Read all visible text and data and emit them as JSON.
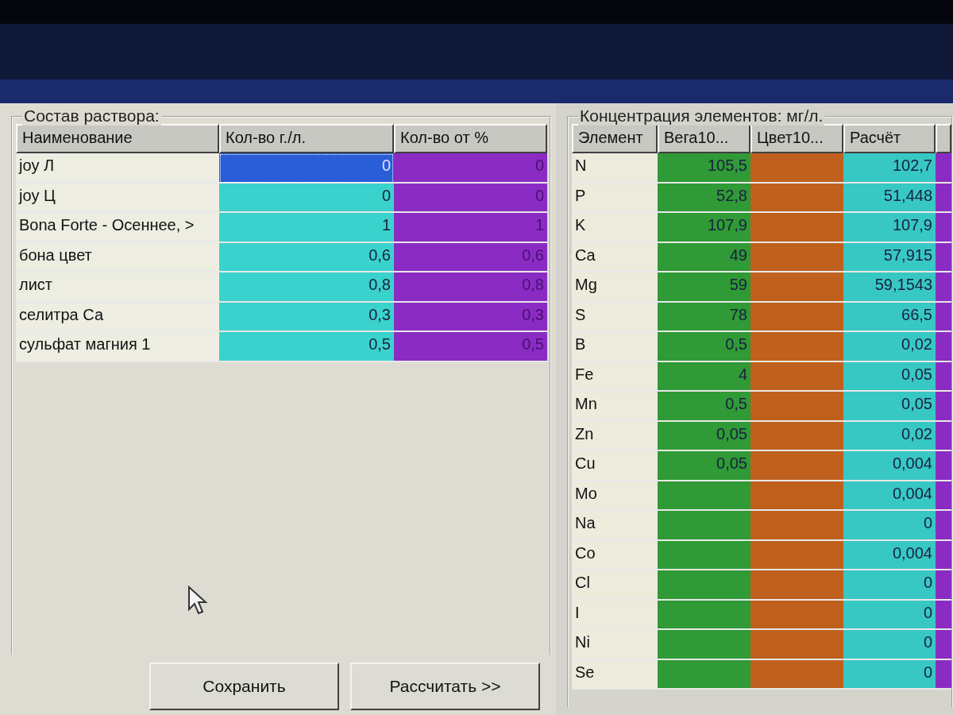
{
  "solution_panel": {
    "title": "Состав раствора:",
    "columns": [
      "Наименование",
      "Кол-во г./л.",
      "Кол-во от %"
    ],
    "rows": [
      {
        "name": "joy Л",
        "grams_per_liter": "0",
        "percent": "0",
        "selected": true
      },
      {
        "name": "joy Ц",
        "grams_per_liter": "0",
        "percent": "0",
        "selected": false
      },
      {
        "name": "Bona Forte - Осеннее, >",
        "grams_per_liter": "1",
        "percent": "1",
        "selected": false
      },
      {
        "name": "бона цвет",
        "grams_per_liter": "0,6",
        "percent": "0,6",
        "selected": false
      },
      {
        "name": "лист",
        "grams_per_liter": "0,8",
        "percent": "0,8",
        "selected": false
      },
      {
        "name": "селитра Са",
        "grams_per_liter": "0,3",
        "percent": "0,3",
        "selected": false
      },
      {
        "name": "сульфат магния 1",
        "grams_per_liter": "0,5",
        "percent": "0,5",
        "selected": false
      }
    ],
    "buttons": [
      "Сохранить",
      "Рассчитать >>"
    ]
  },
  "concentration_panel": {
    "title": "Концентрация элементов: мг/л.",
    "columns": [
      {
        "label": "Элемент",
        "color": "#ecebdc"
      },
      {
        "label": "Вега10...",
        "color": "#2f9a36"
      },
      {
        "label": "Цвет10...",
        "color": "#c0601e"
      },
      {
        "label": "Расчёт",
        "color": "#38c8c4"
      }
    ],
    "rows": [
      {
        "element": "N",
        "vega": "105,5",
        "calc": "102,7"
      },
      {
        "element": "P",
        "vega": "52,8",
        "calc": "51,448"
      },
      {
        "element": "K",
        "vega": "107,9",
        "calc": "107,9"
      },
      {
        "element": "Ca",
        "vega": "49",
        "calc": "57,915"
      },
      {
        "element": "Mg",
        "vega": "59",
        "calc": "59,1543"
      },
      {
        "element": "S",
        "vega": "78",
        "calc": "66,5"
      },
      {
        "element": "B",
        "vega": "0,5",
        "calc": "0,02"
      },
      {
        "element": "Fe",
        "vega": "4",
        "calc": "0,05"
      },
      {
        "element": "Mn",
        "vega": "0,5",
        "calc": "0,05"
      },
      {
        "element": "Zn",
        "vega": "0,05",
        "calc": "0,02"
      },
      {
        "element": "Cu",
        "vega": "0,05",
        "calc": "0,004"
      },
      {
        "element": "Mo",
        "calc": "0,004"
      },
      {
        "element": "Na",
        "calc": "0"
      },
      {
        "element": "Co",
        "calc": "0,004"
      },
      {
        "element": "Cl",
        "calc": "0"
      },
      {
        "element": "I",
        "calc": "0"
      },
      {
        "element": "Ni",
        "calc": "0"
      },
      {
        "element": "Se",
        "calc": "0"
      }
    ]
  }
}
